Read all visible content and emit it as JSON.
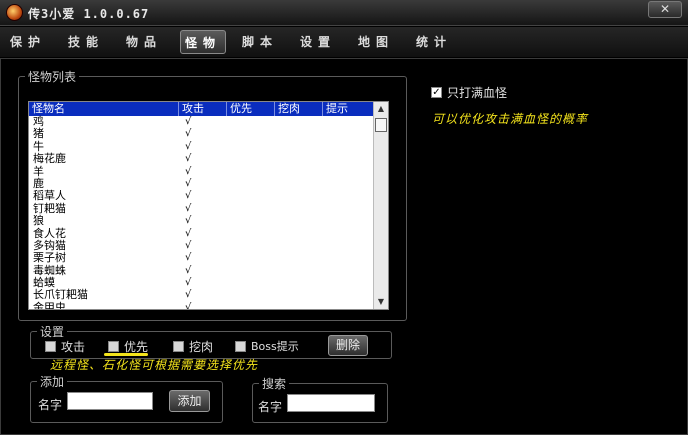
{
  "window": {
    "title": "传3小爱  1.0.0.67",
    "close_label": "✕"
  },
  "tabs": [
    {
      "label": "保护",
      "active": false
    },
    {
      "label": "技能",
      "active": false
    },
    {
      "label": "物品",
      "active": false
    },
    {
      "label": "怪物",
      "active": true
    },
    {
      "label": "脚本",
      "active": false
    },
    {
      "label": "设置",
      "active": false
    },
    {
      "label": "地图",
      "active": false
    },
    {
      "label": "统计",
      "active": false
    }
  ],
  "monster_list": {
    "group_label": "怪物列表",
    "columns": [
      "怪物名",
      "攻击",
      "优先",
      "挖肉",
      "提示"
    ],
    "rows": [
      {
        "name": "鸡",
        "attack": "√"
      },
      {
        "name": "猪",
        "attack": "√"
      },
      {
        "name": "牛",
        "attack": "√"
      },
      {
        "name": "梅花鹿",
        "attack": "√"
      },
      {
        "name": "羊",
        "attack": "√"
      },
      {
        "name": "鹿",
        "attack": "√"
      },
      {
        "name": "稻草人",
        "attack": "√"
      },
      {
        "name": "钉耙猫",
        "attack": "√"
      },
      {
        "name": "狼",
        "attack": "√"
      },
      {
        "name": "食人花",
        "attack": "√"
      },
      {
        "name": "多钩猫",
        "attack": "√"
      },
      {
        "name": "栗子树",
        "attack": "√"
      },
      {
        "name": "毒蜘蛛",
        "attack": "√"
      },
      {
        "name": "蛤蟆",
        "attack": "√"
      },
      {
        "name": "长爪钉耙猫",
        "attack": "√"
      },
      {
        "name": "金甲虫",
        "attack": "√"
      }
    ]
  },
  "settings": {
    "group_label": "设置",
    "attack_label": "攻击",
    "priority_label": "优先",
    "meat_label": "挖肉",
    "boss_label": "Boss提示",
    "delete_label": "删除"
  },
  "hint_left": "远程怪、石化怪可根据需要选择优先",
  "add": {
    "group_label": "添加",
    "name_label": "名字",
    "name_value": "",
    "add_label": "添加"
  },
  "search": {
    "group_label": "搜索",
    "name_label": "名字",
    "name_value": ""
  },
  "full_hp": {
    "label": "只打满血怪",
    "checked": true,
    "check_mark": "✓",
    "hint": "可以优化攻击满血怪的概率"
  },
  "colors": {
    "accent": "#0a2dbe",
    "hint": "#f4e41c"
  }
}
